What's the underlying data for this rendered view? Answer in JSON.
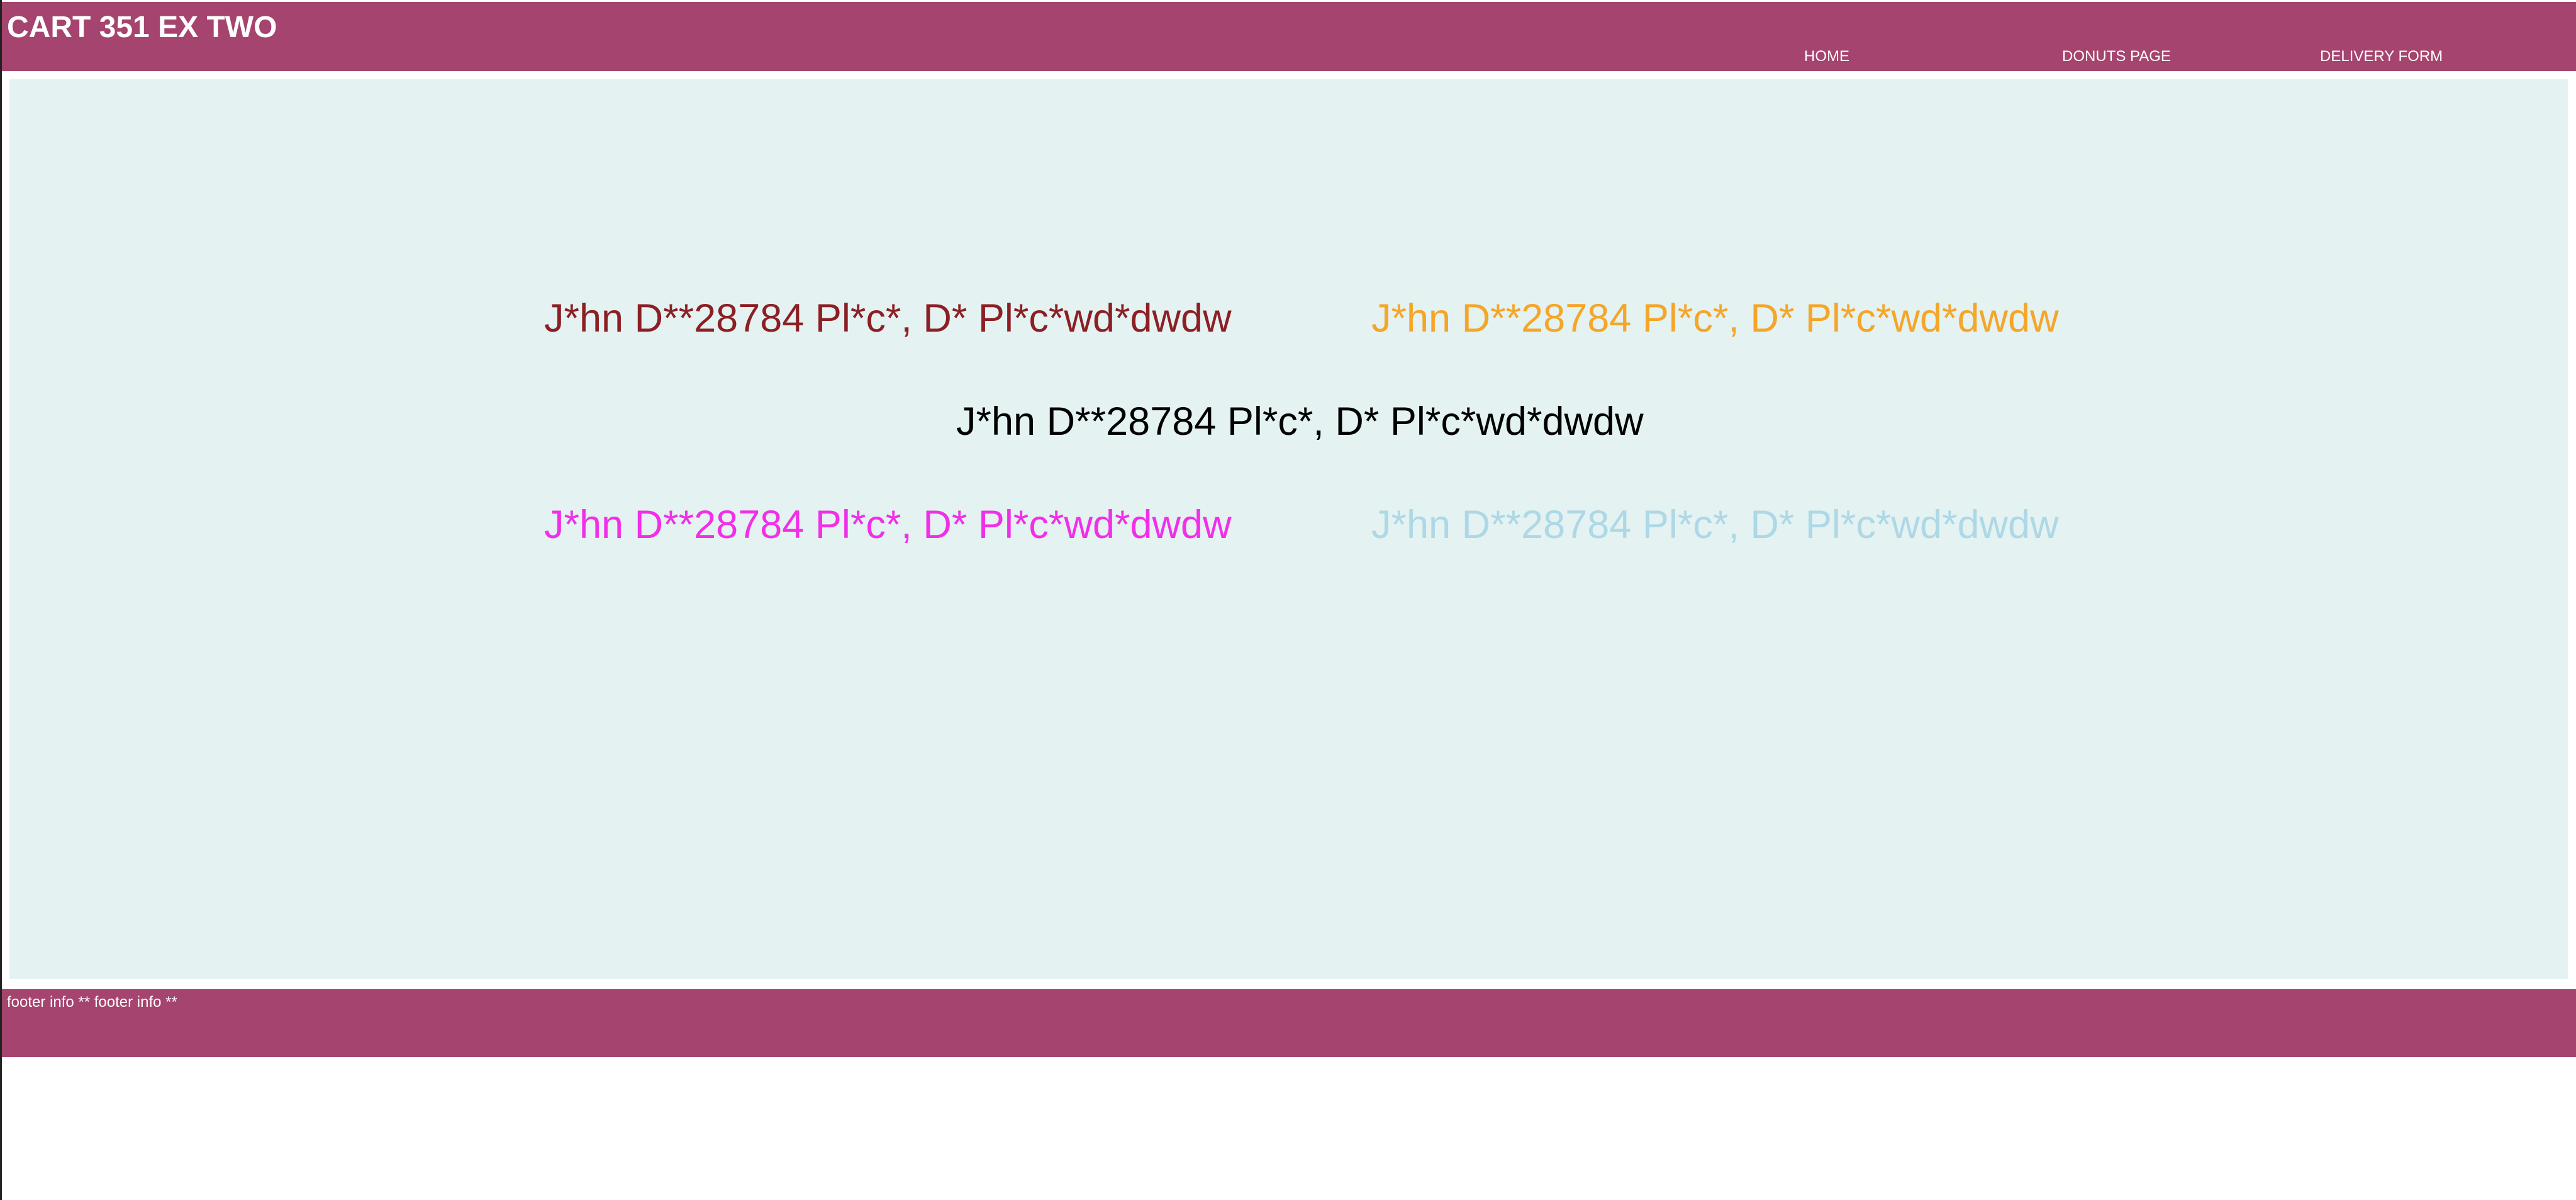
{
  "header": {
    "title": "CART 351 EX TWO",
    "nav": [
      {
        "label": "HOME"
      },
      {
        "label": "DONUTS PAGE"
      },
      {
        "label": "DELIVERY FORM"
      }
    ]
  },
  "main": {
    "items": [
      {
        "text": "J*hn D**28784 Pl*c*, D* Pl*c*wd*dwdw",
        "color": "#8c1f24"
      },
      {
        "text": "J*hn D**28784 Pl*c*, D* Pl*c*wd*dwdw",
        "color": "#f5a528"
      },
      {
        "text": "J*hn D**28784 Pl*c*, D* Pl*c*wd*dwdw",
        "color": "#000000"
      },
      {
        "text": "J*hn D**28784 Pl*c*, D* Pl*c*wd*dwdw",
        "color": "#f22ee9"
      },
      {
        "text": "J*hn D**28784 Pl*c*, D* Pl*c*wd*dwdw",
        "color": "#add8e6"
      }
    ]
  },
  "footer": {
    "text": "footer info ** footer info **"
  },
  "colors": {
    "bar": "#a5446e",
    "content_background": "#e4f2f2"
  }
}
